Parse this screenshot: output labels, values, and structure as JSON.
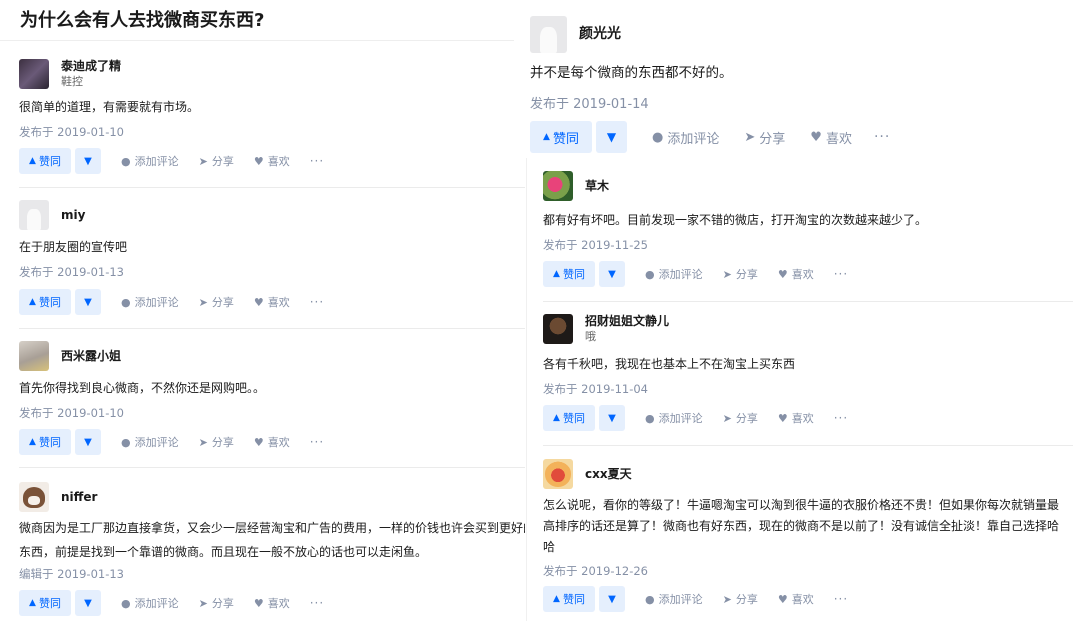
{
  "question": {
    "title": "为什么会有人去找微商买东西?"
  },
  "actions": {
    "upvote": "赞同",
    "comment": "添加评论",
    "share": "分享",
    "like": "喜欢",
    "more": "···"
  },
  "icons": {
    "upvote": "triangle-up-icon",
    "downvote": "triangle-down-icon",
    "comment": "comment-bubble-icon",
    "share": "paper-plane-icon",
    "like": "heart-icon",
    "more": "more-dots-icon"
  },
  "colors": {
    "accent": "#0066ff",
    "vote_bg": "#e5effd",
    "meta": "#8590a6"
  },
  "left_answers": [
    {
      "author": "泰迪成了精",
      "bio": "鞋控",
      "content": [
        "很简单的道理，有需要就有市场。"
      ],
      "date": "发布于 2019-01-10"
    },
    {
      "author": "miy",
      "bio": "",
      "content": [
        "在于朋友圈的宣传吧"
      ],
      "date": "发布于 2019-01-13"
    },
    {
      "author": "西米露小姐",
      "bio": "",
      "content": [
        "首先你得找到良心微商，不然你还是网购吧。。"
      ],
      "date": "发布于 2019-01-10"
    },
    {
      "author": "niffer",
      "bio": "",
      "content": [
        "微商因为是工厂那边直接拿货，又会少一层经营淘宝和广告的费用，一样的价钱也许会买到更好的",
        "东西，前提是找到一个靠谱的微商。而且现在一般不放心的话也可以走闲鱼。"
      ],
      "date": "编辑于 2019-01-13"
    }
  ],
  "right_top_answer": {
    "author": "颜光光",
    "content": "并不是每个微商的东西都不好的。",
    "date": "发布于 2019-01-14"
  },
  "right_answers": [
    {
      "author": "草木",
      "bio": "",
      "content": [
        "都有好有坏吧。目前发现一家不错的微店，打开淘宝的次数越来越少了。"
      ],
      "date": "发布于 2019-11-25"
    },
    {
      "author": "招财姐姐文静儿",
      "bio": "哦",
      "content": [
        "各有千秋吧，我现在也基本上不在淘宝上买东西"
      ],
      "date": "发布于 2019-11-04"
    },
    {
      "author": "cxx夏天",
      "bio": "",
      "content": [
        "怎么说呢，看你的等级了！牛逼嗯淘宝可以淘到很牛逼的衣服价格还不贵！但如果你每次就销量最",
        "高排序的话还是算了！微商也有好东西，现在的微商不是以前了！没有诚信全扯淡！靠自己选择哈",
        "哈"
      ],
      "date": "发布于 2019-12-26"
    }
  ]
}
